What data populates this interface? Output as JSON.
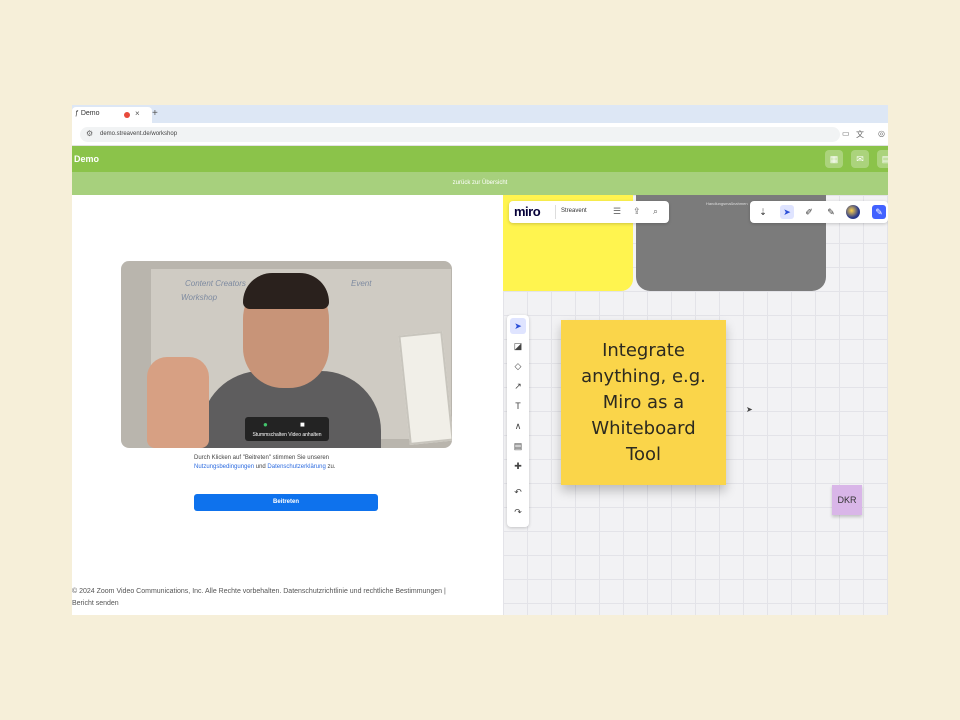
{
  "browser": {
    "tab_title": "ƒ Demo",
    "tab_close": "×",
    "new_tab": "+",
    "address": "demo.streavent.de/workshop"
  },
  "app": {
    "title": "Demo",
    "back_link": "zurück zur Übersicht"
  },
  "zoom": {
    "video_controls_label": "Stummschalten Video anhalten",
    "whiteboard_notes": [
      "Content Creators",
      "Workshop",
      "Event"
    ],
    "terms_text_1": "Durch Klicken auf \"Beitreten\" stimmen Sie unseren",
    "terms_link_1": "Nutzungsbedingungen",
    "terms_and": "und",
    "terms_link_2": "Datenschutzerklärung",
    "terms_end": "zu.",
    "join_button": "Beitreten",
    "footer_line1": "© 2024 Zoom Video Communications, Inc. Alle Rechte vorbehalten. Datenschutzrichtlinie und rechtliche Bestimmungen  |",
    "footer_line2": "Bericht senden"
  },
  "miro": {
    "brand": "miro",
    "board_name": "Streavent",
    "frame_label": "Handlungsmaßnahmen",
    "sticky_text": "Integrate anything, e.g. Miro as a Whiteboard Tool",
    "small_sticky": "DKR"
  },
  "colors": {
    "green_bar": "#8bc34a",
    "light_green_bar": "#a7d07d",
    "join_blue": "#0e72ed",
    "sticky_yellow": "#fad54a",
    "miro_blue": "#4262ff",
    "page_bg": "#f6efd9"
  }
}
